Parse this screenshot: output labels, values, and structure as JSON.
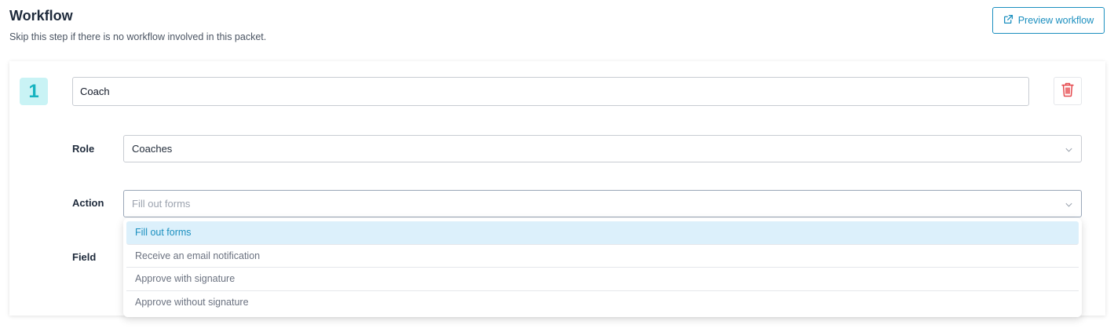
{
  "header": {
    "title": "Workflow",
    "subtitle": "Skip this step if there is no workflow involved in this packet.",
    "preview_button": "Preview workflow",
    "preview_icon": "external-link-icon"
  },
  "step": {
    "number": "1",
    "name_value": "Coach",
    "delete_icon": "trash-icon",
    "role": {
      "label": "Role",
      "value": "Coaches"
    },
    "action": {
      "label": "Action",
      "placeholder": "Fill out forms",
      "open": true
    },
    "field": {
      "label": "Field"
    }
  },
  "action_options": [
    {
      "label": "Fill out forms",
      "highlighted": true
    },
    {
      "label": "Receive an email notification",
      "highlighted": false
    },
    {
      "label": "Approve with signature",
      "highlighted": false
    },
    {
      "label": "Approve without signature",
      "highlighted": false
    }
  ],
  "colors": {
    "accent": "#1b8fbf",
    "badge_bg": "#c9f3f5",
    "badge_text": "#17b3c0",
    "danger": "#e5484d",
    "option_highlight": "#dcf0fb"
  }
}
